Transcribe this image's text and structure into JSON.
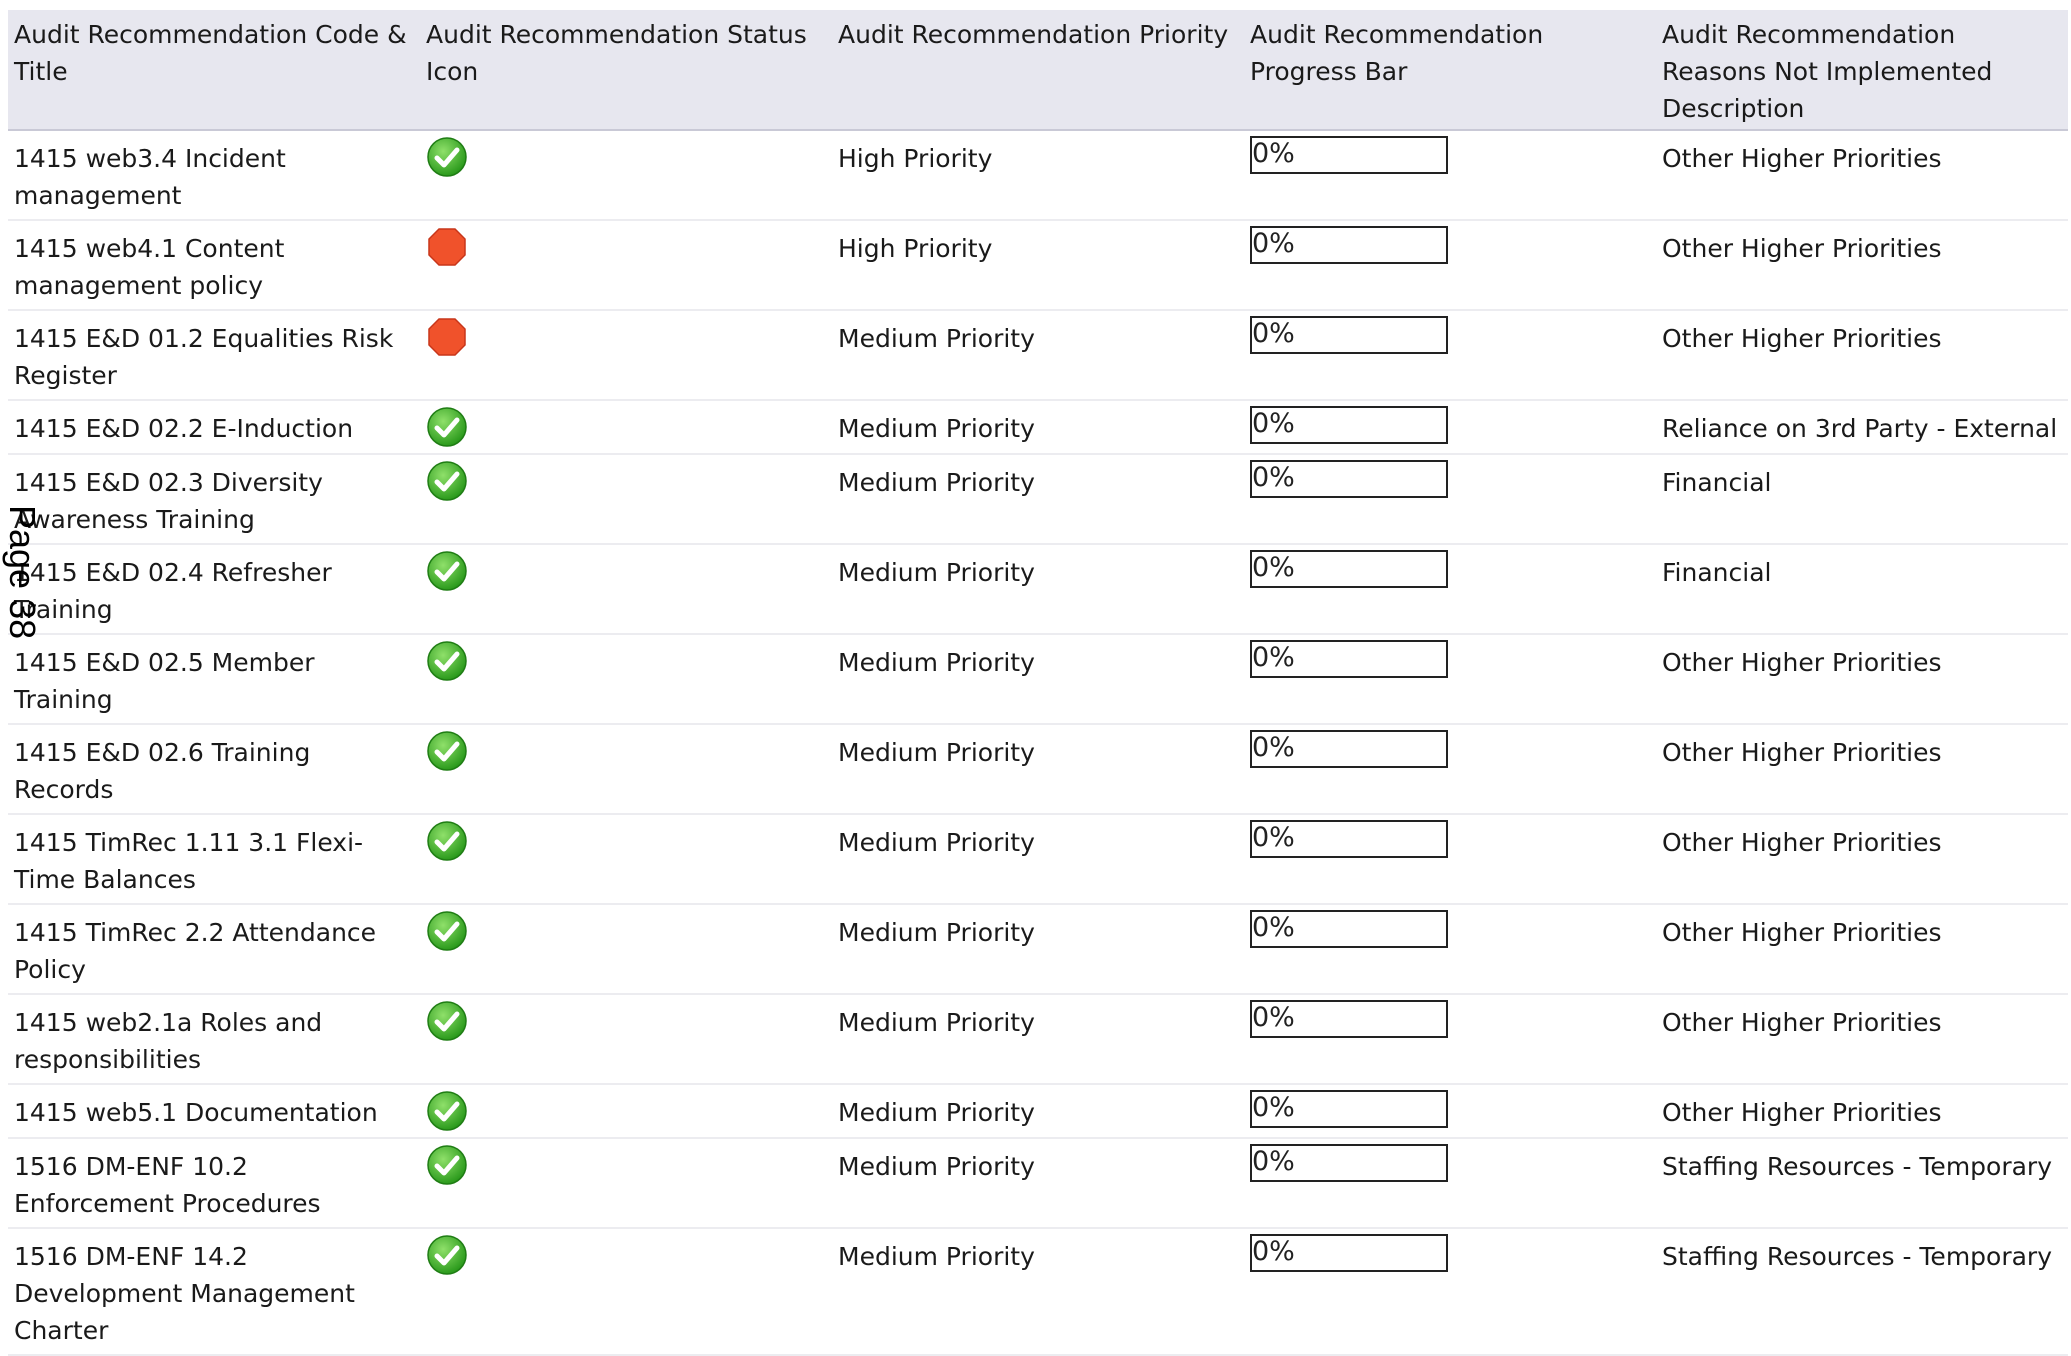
{
  "headers": [
    "Audit Recommendation Code & Title",
    "Audit Recommendation Status Icon",
    "Audit Recommendation Priority",
    "Audit Recommendation Progress Bar",
    "Audit Recommendation Reasons Not Implemented Description"
  ],
  "page_mark": "Page 38",
  "icons": {
    "completed": "check-circle-icon",
    "overdue": "stop-octagon-icon"
  },
  "colors": {
    "header_bg": "#e7e7ef",
    "check_green": "#3fae2a",
    "stop_red": "#f0522b"
  },
  "rows": [
    {
      "code_title": "1415 web3.4 Incident management",
      "status": "completed",
      "priority": "High Priority",
      "progress": 0,
      "progress_label": "0%",
      "reason": "Other Higher Priorities"
    },
    {
      "code_title": "1415 web4.1 Content management policy",
      "status": "overdue",
      "priority": "High Priority",
      "progress": 0,
      "progress_label": "0%",
      "reason": "Other Higher Priorities"
    },
    {
      "code_title": "1415 E&D 01.2 Equalities Risk Register",
      "status": "overdue",
      "priority": "Medium Priority",
      "progress": 0,
      "progress_label": "0%",
      "reason": "Other Higher Priorities"
    },
    {
      "code_title": "1415 E&D 02.2 E-Induction",
      "status": "completed",
      "priority": "Medium Priority",
      "progress": 0,
      "progress_label": "0%",
      "reason": "Reliance on 3rd Party - External"
    },
    {
      "code_title": "1415 E&D 02.3 Diversity Awareness Training",
      "status": "completed",
      "priority": "Medium Priority",
      "progress": 0,
      "progress_label": "0%",
      "reason": "Financial"
    },
    {
      "code_title": "1415 E&D 02.4 Refresher Training",
      "status": "completed",
      "priority": "Medium Priority",
      "progress": 0,
      "progress_label": "0%",
      "reason": "Financial"
    },
    {
      "code_title": "1415 E&D 02.5 Member Training",
      "status": "completed",
      "priority": "Medium Priority",
      "progress": 0,
      "progress_label": "0%",
      "reason": "Other Higher Priorities"
    },
    {
      "code_title": "1415 E&D 02.6 Training Records",
      "status": "completed",
      "priority": "Medium Priority",
      "progress": 0,
      "progress_label": "0%",
      "reason": "Other Higher Priorities"
    },
    {
      "code_title": "1415 TimRec 1.11 3.1 Flexi-Time Balances",
      "status": "completed",
      "priority": "Medium Priority",
      "progress": 0,
      "progress_label": "0%",
      "reason": "Other Higher Priorities"
    },
    {
      "code_title": "1415 TimRec 2.2 Attendance Policy",
      "status": "completed",
      "priority": "Medium Priority",
      "progress": 0,
      "progress_label": "0%",
      "reason": "Other Higher Priorities"
    },
    {
      "code_title": "1415 web2.1a Roles and responsibilities",
      "status": "completed",
      "priority": "Medium Priority",
      "progress": 0,
      "progress_label": "0%",
      "reason": "Other Higher Priorities"
    },
    {
      "code_title": "1415 web5.1 Documentation",
      "status": "completed",
      "priority": "Medium Priority",
      "progress": 0,
      "progress_label": "0%",
      "reason": "Other Higher Priorities"
    },
    {
      "code_title": "1516 DM-ENF 10.2 Enforcement Procedures",
      "status": "completed",
      "priority": "Medium Priority",
      "progress": 0,
      "progress_label": "0%",
      "reason": "Staffing Resources - Temporary"
    },
    {
      "code_title": "1516 DM-ENF 14.2 Development Management Charter",
      "status": "completed",
      "priority": "Medium Priority",
      "progress": 0,
      "progress_label": "0%",
      "reason": "Staffing Resources - Temporary"
    }
  ]
}
